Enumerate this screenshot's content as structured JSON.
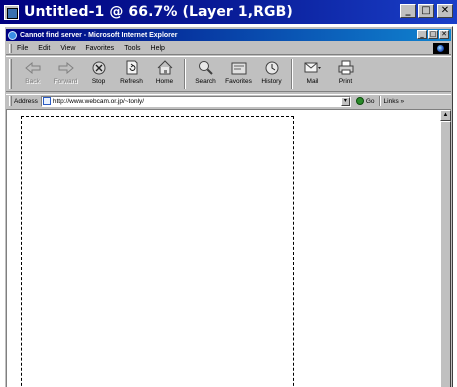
{
  "outer_window": {
    "title": "Untitled-1 @ 66.7% (Layer 1,RGB)",
    "minimize": "_",
    "maximize": "□",
    "close": "✕"
  },
  "browser": {
    "title": "Cannot find server - Microsoft Internet Explorer",
    "minimize": "_",
    "maximize": "□",
    "close": "✕",
    "menu": [
      "File",
      "Edit",
      "View",
      "Favorites",
      "Tools",
      "Help"
    ],
    "toolbar": [
      {
        "label": "Back",
        "icon": "back-arrow-icon",
        "enabled": false
      },
      {
        "label": "Forward",
        "icon": "forward-arrow-icon",
        "enabled": false
      },
      {
        "label": "Stop",
        "icon": "stop-icon",
        "enabled": true
      },
      {
        "label": "Refresh",
        "icon": "refresh-icon",
        "enabled": true
      },
      {
        "label": "Home",
        "icon": "home-icon",
        "enabled": true
      },
      {
        "label": "Search",
        "icon": "search-icon",
        "enabled": true
      },
      {
        "label": "Favorites",
        "icon": "favorites-icon",
        "enabled": true
      },
      {
        "label": "History",
        "icon": "history-icon",
        "enabled": true
      },
      {
        "label": "Mail",
        "icon": "mail-icon",
        "enabled": true
      },
      {
        "label": "Print",
        "icon": "print-icon",
        "enabled": true
      }
    ],
    "address_label": "Address",
    "address_url": "http://www.webcam.or.jp/~tonly/",
    "address_dropdown": "▾",
    "go_label": "Go",
    "links_label": "Links »"
  },
  "content": {
    "scroll_up": "▲"
  }
}
